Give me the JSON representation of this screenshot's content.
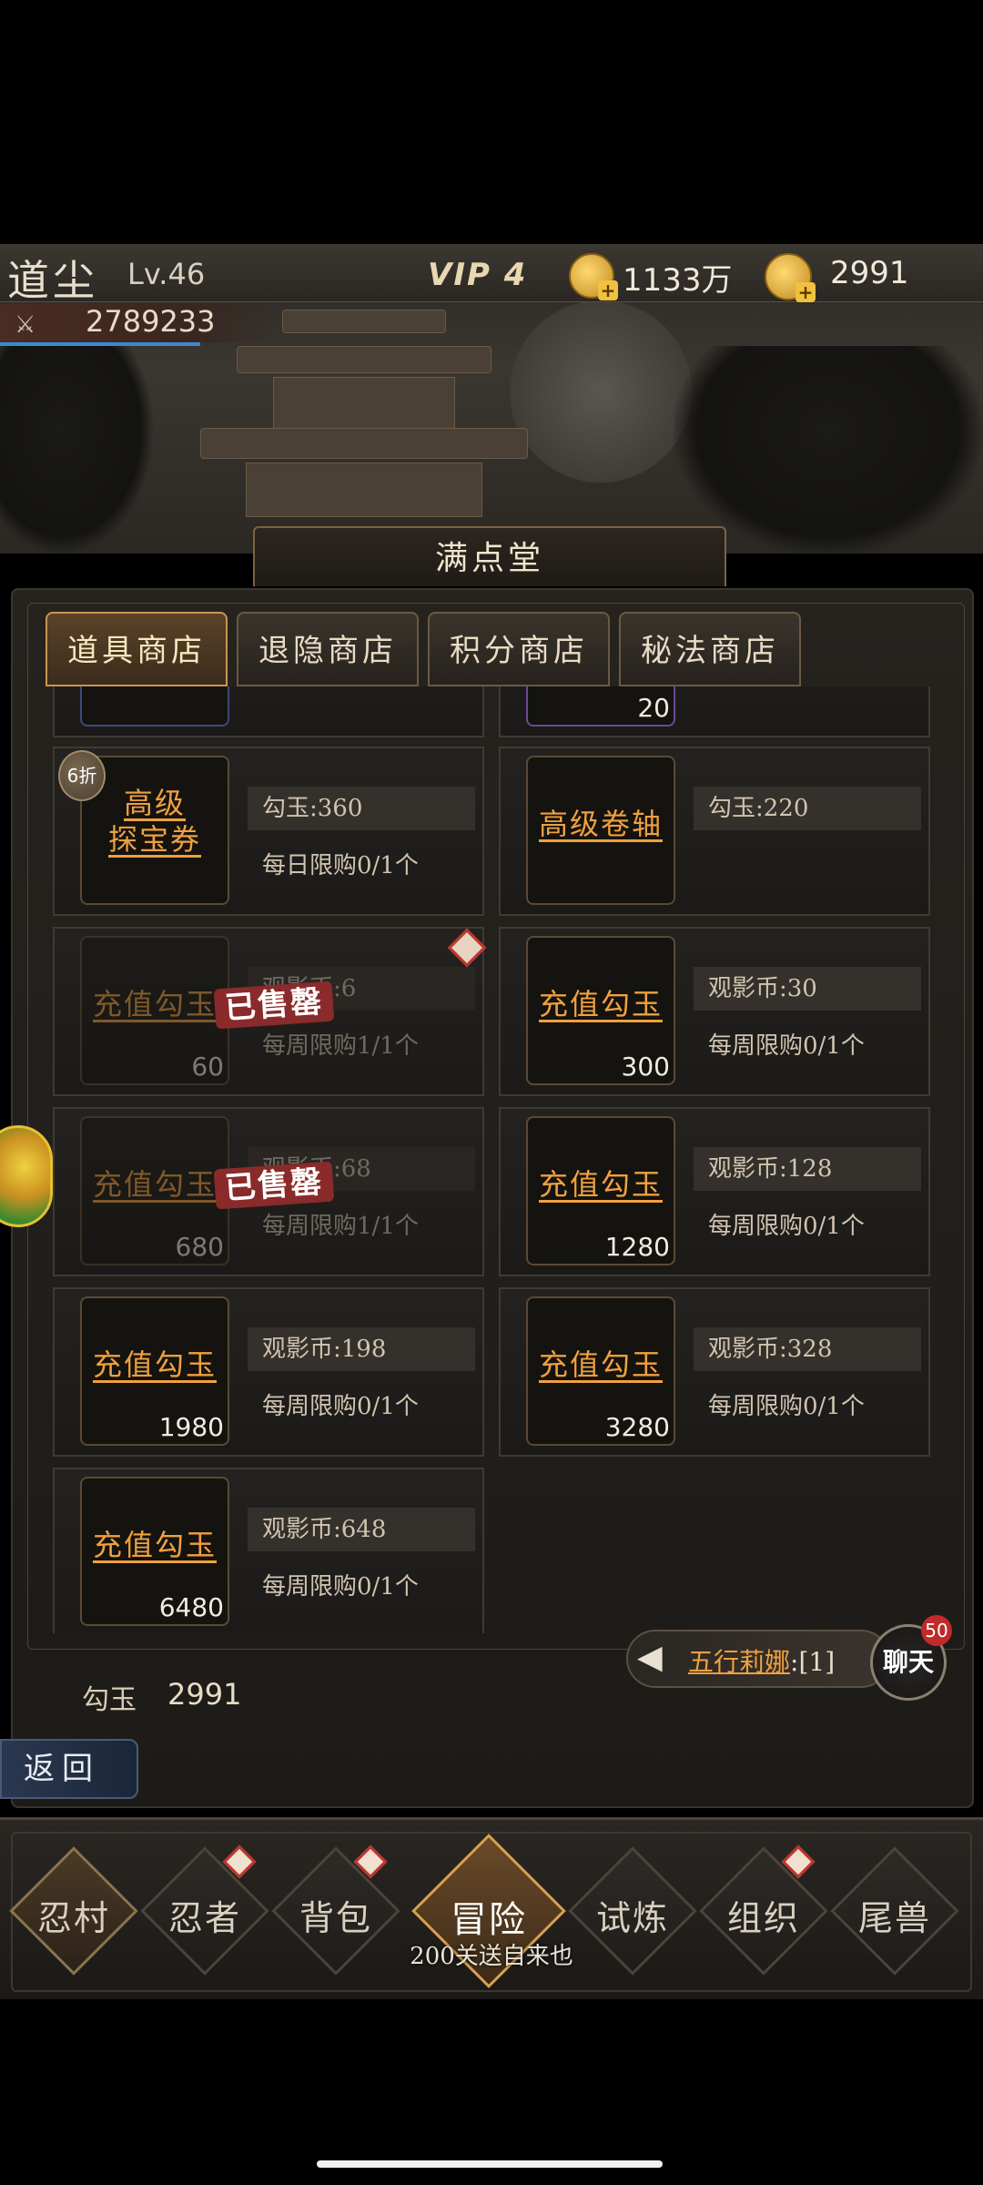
{
  "player": {
    "name": "道尘",
    "level": "Lv.46",
    "power": "2789233",
    "vip": "VIP 4"
  },
  "resources": {
    "coins": "1133万",
    "jade": "2991"
  },
  "shop": {
    "title": "满点堂",
    "tabs": [
      "道具商店",
      "退隐商店",
      "积分商店",
      "秘法商店"
    ],
    "partial_top_count": "20",
    "items": [
      {
        "name_line1": "高级",
        "name_line2": "探宝券",
        "count": "",
        "price": "勾玉:360",
        "limit": "每日限购0/1个",
        "discount": "6折",
        "sold_out": false
      },
      {
        "name": "高级卷轴",
        "count": "",
        "price": "勾玉:220",
        "limit": "",
        "sold_out": false
      },
      {
        "name": "充值勾玉",
        "count": "60",
        "price": "观影币:6",
        "limit": "每周限购1/1个",
        "sold_out": true,
        "sold_label": "已售罄"
      },
      {
        "name": "充值勾玉",
        "count": "300",
        "price": "观影币:30",
        "limit": "每周限购0/1个",
        "sold_out": false
      },
      {
        "name": "充值勾玉",
        "count": "680",
        "price": "观影币:68",
        "limit": "每周限购1/1个",
        "sold_out": true,
        "sold_label": "已售罄"
      },
      {
        "name": "充值勾玉",
        "count": "1280",
        "price": "观影币:128",
        "limit": "每周限购0/1个",
        "sold_out": false
      },
      {
        "name": "充值勾玉",
        "count": "1980",
        "price": "观影币:198",
        "limit": "每周限购0/1个",
        "sold_out": false
      },
      {
        "name": "充值勾玉",
        "count": "3280",
        "price": "观影币:328",
        "limit": "每周限购0/1个",
        "sold_out": false
      },
      {
        "name": "充值勾玉",
        "count": "6480",
        "price": "观影币:648",
        "limit": "每周限购0/1个",
        "sold_out": false
      }
    ],
    "currency_label": "勾玉",
    "currency_value": "2991"
  },
  "back_label": "返回",
  "chat": {
    "sender": "五行莉娜",
    "message": ":[1]",
    "button": "聊天",
    "unread": "50"
  },
  "nav": {
    "items": [
      "忍村",
      "忍者",
      "背包",
      "冒险",
      "试炼",
      "组织",
      "尾兽"
    ],
    "subtitle": "200关送自来也"
  }
}
